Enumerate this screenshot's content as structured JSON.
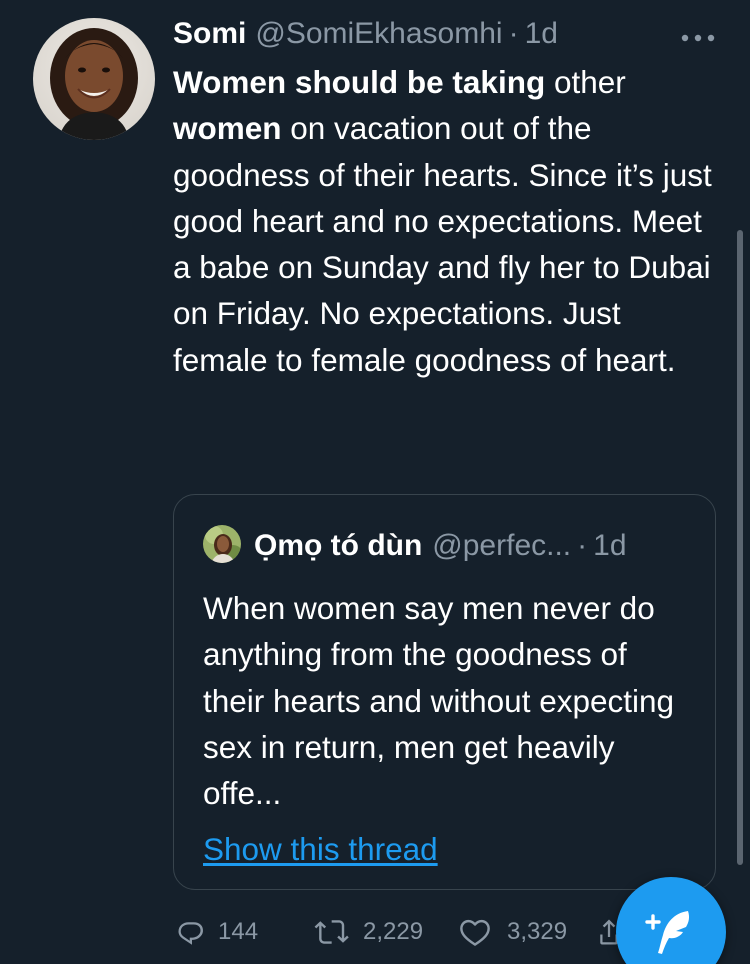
{
  "tweet": {
    "author_name": "Somi",
    "author_handle": "@SomiEkhasomhi",
    "separator": "·",
    "time": "1d",
    "text_segments": [
      {
        "text": "Women should be taking",
        "bold": true
      },
      {
        "text": " other ",
        "bold": false
      },
      {
        "text": "women",
        "bold": true
      },
      {
        "text": " on vacation out of the goodness of their hearts. Since it’s just good heart and no expectations. Meet a babe on Sunday and fly her to Dubai on Friday. No expectations. Just female to female goodness of heart.",
        "bold": false
      }
    ]
  },
  "quoted_tweet": {
    "author_name": "Ọmọ tó dùn",
    "author_handle": "@perfec...",
    "separator": "·",
    "time": "1d",
    "text": "When women say men never do anything from the goodness of their hearts and without expecting sex in return, men get heavily offe...",
    "show_thread_label": "Show this thread"
  },
  "actions": {
    "replies": "144",
    "retweets": "2,229",
    "likes": "3,329"
  },
  "icons": {
    "more": "more-horizontal-icon",
    "reply": "reply-icon",
    "retweet": "retweet-icon",
    "like": "heart-icon",
    "share": "share-icon",
    "compose": "compose-tweet-icon"
  },
  "colors": {
    "background": "#15202b",
    "text": "#ffffff",
    "secondary_text": "#8b98a5",
    "accent": "#1d9bf0",
    "border": "#38444d"
  }
}
